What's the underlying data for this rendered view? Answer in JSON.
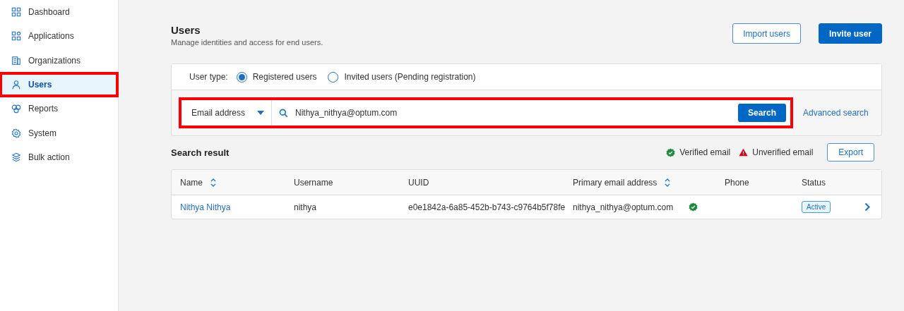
{
  "sidebar": {
    "items": [
      {
        "label": "Dashboard",
        "selected": false,
        "highlighted": false
      },
      {
        "label": "Applications",
        "selected": false,
        "highlighted": false
      },
      {
        "label": "Organizations",
        "selected": false,
        "highlighted": false
      },
      {
        "label": "Users",
        "selected": true,
        "highlighted": true
      },
      {
        "label": "Reports",
        "selected": false,
        "highlighted": false
      },
      {
        "label": "System",
        "selected": false,
        "highlighted": false
      },
      {
        "label": "Bulk action",
        "selected": false,
        "highlighted": false
      }
    ]
  },
  "header": {
    "title": "Users",
    "subtitle": "Manage identities and access for end users.",
    "buttons": [
      {
        "label": "Import users",
        "kind": "secondary"
      },
      {
        "label": "Invite user",
        "kind": "primary"
      }
    ]
  },
  "filter": {
    "label": "User type:",
    "options": [
      {
        "label": "Registered users",
        "selected": true
      },
      {
        "label": "Invited users (Pending registration)",
        "selected": false
      }
    ]
  },
  "search": {
    "field": "Email address",
    "value": "Nithya_nithya@optum.com",
    "button": "Search",
    "highlighted": true,
    "advanced": "Advanced search"
  },
  "results": {
    "title": "Search result",
    "legend": [
      {
        "label": "Verified email",
        "kind": "verified"
      },
      {
        "label": "Unverified email",
        "kind": "unverified"
      }
    ],
    "export": "Export"
  },
  "table": {
    "columns": [
      {
        "label": "Name",
        "sortable": true
      },
      {
        "label": "Username",
        "sortable": false
      },
      {
        "label": "UUID",
        "sortable": false
      },
      {
        "label": "Primary email address",
        "sortable": true
      },
      {
        "label": "Phone",
        "sortable": false
      },
      {
        "label": "Status",
        "sortable": false
      }
    ],
    "rows": [
      {
        "name": "Nithya Nithya",
        "username": "nithya",
        "uuid": "e0e1842a-6a85-452b-b743-c9764b5f78fe",
        "email": "nithya_nithya@optum.com",
        "email_verified": true,
        "status": "Active"
      }
    ]
  }
}
